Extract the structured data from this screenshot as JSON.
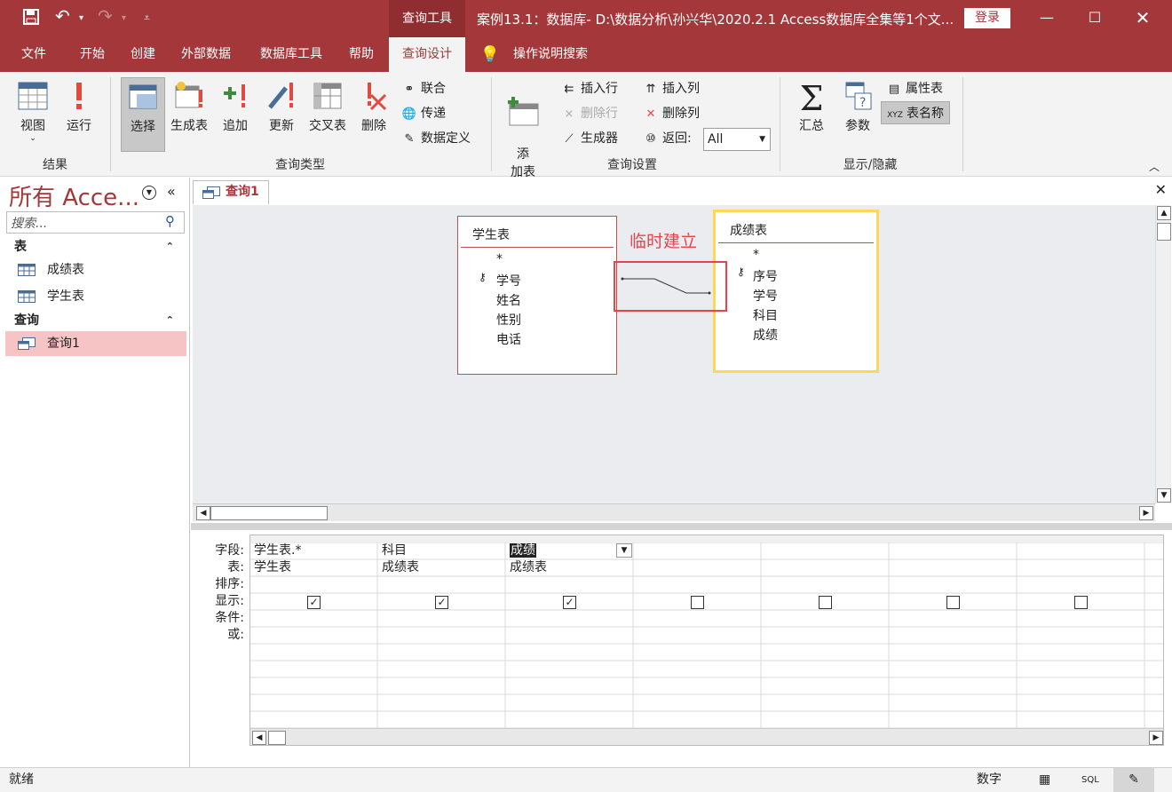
{
  "title_bar": {
    "context_tab": "查询工具",
    "document_title": "案例13.1：数据库- D:\\数据分析\\孙兴华\\2020.2.1 Access数据库全集等1个文...",
    "signin": "登录"
  },
  "menu": [
    "文件",
    "开始",
    "创建",
    "外部数据",
    "数据库工具",
    "帮助",
    "查询设计",
    "操作说明搜索"
  ],
  "ribbon": {
    "results": {
      "label": "结果",
      "view": "视图",
      "run": "运行"
    },
    "query_type": {
      "label": "查询类型",
      "select": "选择",
      "make_table": "生成表",
      "append": "追加",
      "update": "更新",
      "crosstab": "交叉表",
      "delete": "删除",
      "union": "联合",
      "pass_through": "传递",
      "data_definition": "数据定义"
    },
    "query_setup": {
      "label": "查询设置",
      "add_table": "添\n加表",
      "insert_rows": "插入行",
      "delete_rows": "删除行",
      "builder": "生成器",
      "insert_columns": "插入列",
      "delete_columns": "删除列",
      "return_label": "返回:",
      "return_value": "All"
    },
    "show_hide": {
      "label": "显示/隐藏",
      "totals": "汇总",
      "parameters": "参数",
      "property_sheet": "属性表",
      "table_names": "表名称"
    }
  },
  "nav": {
    "title": "所有 Acce...",
    "search_placeholder": "搜索...",
    "sections": [
      {
        "label": "表",
        "items": [
          "成绩表",
          "学生表"
        ]
      },
      {
        "label": "查询",
        "items": [
          "查询1"
        ]
      }
    ]
  },
  "doc": {
    "tab_label": "查询1",
    "tables": [
      {
        "name": "学生表",
        "fields": [
          "*",
          "学号",
          "姓名",
          "性别",
          "电话"
        ],
        "key": "学号"
      },
      {
        "name": "成绩表",
        "fields": [
          "*",
          "序号",
          "学号",
          "科目",
          "成绩"
        ],
        "key": "序号"
      }
    ],
    "annotation": "临时建立"
  },
  "grid": {
    "row_labels": [
      "字段:",
      "表:",
      "排序:",
      "显示:",
      "条件:",
      "或:"
    ],
    "columns": [
      {
        "field": "学生表.*",
        "table": "学生表",
        "show": true
      },
      {
        "field": "科目",
        "table": "成绩表",
        "show": true
      },
      {
        "field": "成绩",
        "table": "成绩表",
        "show": true
      },
      {
        "field": "",
        "table": "",
        "show": false
      },
      {
        "field": "",
        "table": "",
        "show": false
      },
      {
        "field": "",
        "table": "",
        "show": false
      },
      {
        "field": "",
        "table": "",
        "show": false
      }
    ]
  },
  "status": {
    "left": "就绪",
    "numlock": "数字",
    "sql": "SQL"
  }
}
